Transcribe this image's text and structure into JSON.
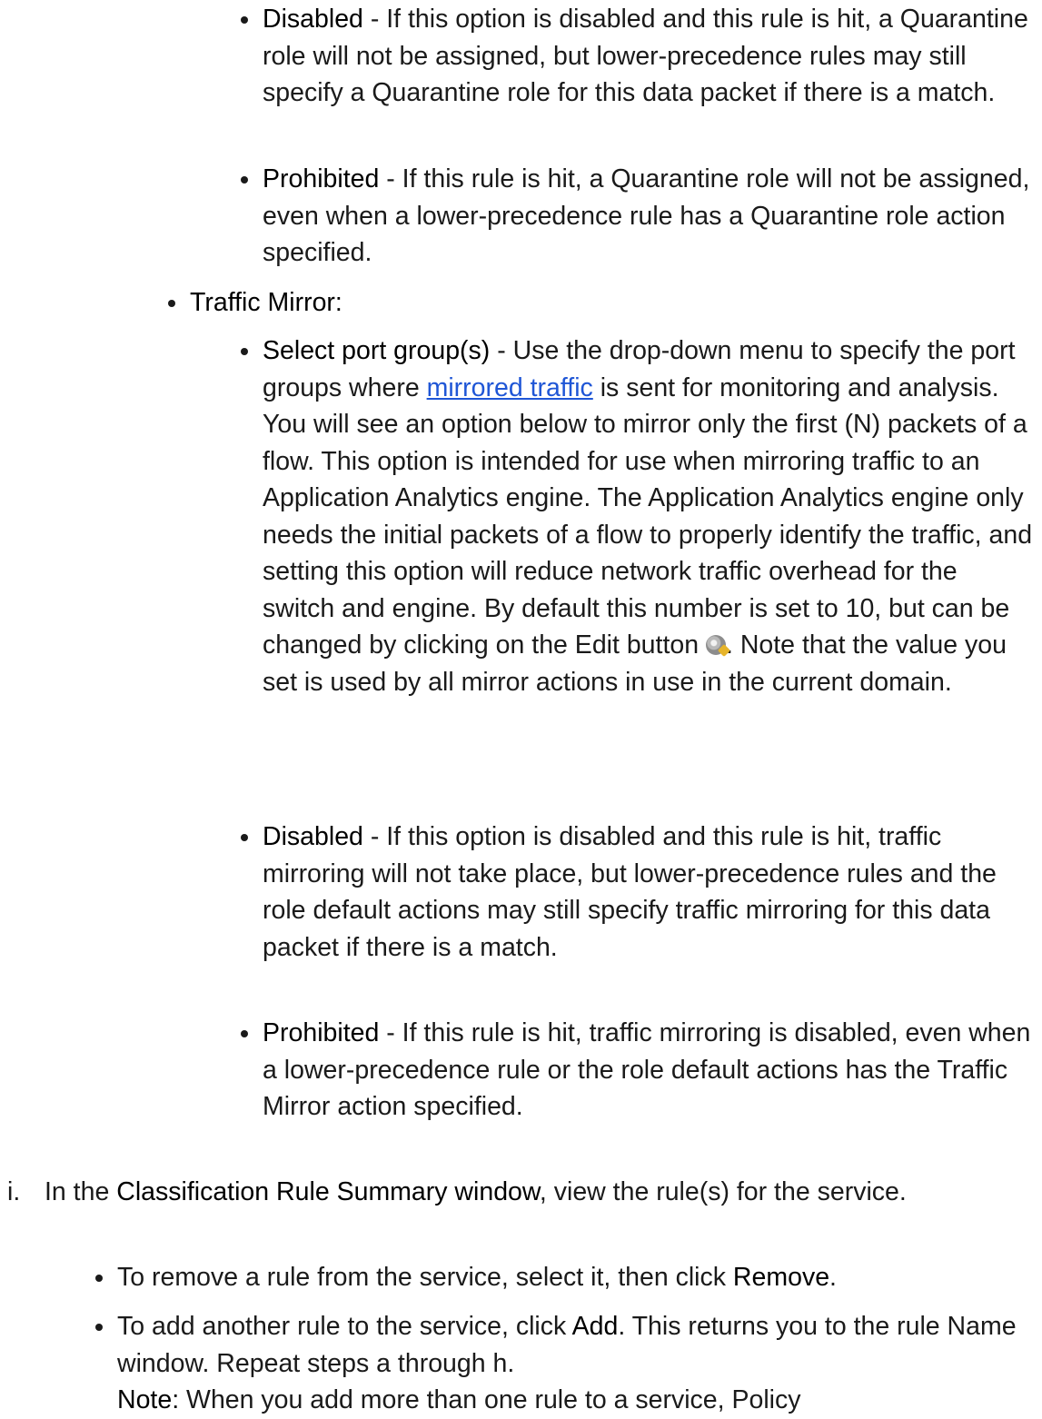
{
  "quarantine": {
    "disabled": {
      "term": "Disabled",
      "text": " - If this option is disabled and this rule is hit, a Quarantine role will not be assigned, but lower-precedence rules may still specify a Quarantine role for this data packet if there is a match."
    },
    "prohibited": {
      "term": "Prohibited",
      "text": " - If this rule is hit, a Quarantine role will not be assigned, even when a lower-precedence rule has a Quarantine role action specified."
    }
  },
  "traffic_mirror": {
    "heading": "Traffic Mirror:",
    "select": {
      "term": "Select port group(s)",
      "text_before": " - Use the drop-down menu to specify the port groups where ",
      "link": "mirrored traffic",
      "text_after": " is sent for monitoring and analysis.",
      "para_before_icon": "You will see an option below to mirror only the first (N) packets of a flow. This option is intended for use when mirroring traffic to an Application Analytics engine. The Application Analytics engine only needs the initial packets of a flow to properly identify the traffic, and setting this option will reduce network traffic overhead for the switch and engine. By default this number is set to 10, but can be changed by clicking on the Edit button ",
      "icon": "edit-gear-icon",
      "para_after_icon": ". Note that the value you set is used by all mirror actions in use in the current domain."
    },
    "disabled": {
      "term": "Disabled",
      "text": " - If this option is disabled and this rule is hit, traffic mirroring will not take place, but lower-precedence rules and the role default actions may still specify traffic mirroring for this data packet if there is a match."
    },
    "prohibited": {
      "term": "Prohibited",
      "text": " - If this rule is hit, traffic mirroring is disabled, even when a lower-precedence rule or the role default actions has the Traffic Mirror action specified."
    }
  },
  "step_i": {
    "marker": "i.",
    "text_before": "In the ",
    "term": "Classification Rule Summary window",
    "text_after": ", view the rule(s) for the service.",
    "remove": {
      "text_before": "To remove a rule from the service, select it, then click ",
      "term": "Remove",
      "text_after": "."
    },
    "add": {
      "text_before": "To add another rule to the service, click ",
      "term": "Add",
      "text_after": ". This returns you to the rule Name window. Repeat steps a through h."
    },
    "note": {
      "term": "Note:",
      "text": " When you add more than one rule to a service, Policy"
    }
  }
}
